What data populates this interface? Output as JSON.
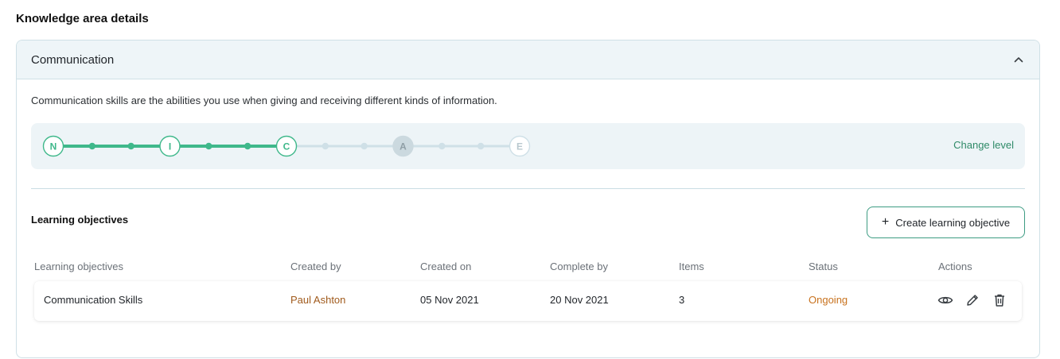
{
  "page_title": "Knowledge area details",
  "area": {
    "title": "Communication",
    "description": "Communication skills are the abilities you use when giving and receiving different kinds of information."
  },
  "level": {
    "stages": [
      "N",
      "I",
      "C",
      "A",
      "E"
    ],
    "current_stage": "C",
    "progress_stage_index": 2,
    "change_label": "Change level",
    "colors": {
      "done": "#3fb88b",
      "pending": "#cfe0e7",
      "highlight": "#cbd9df"
    }
  },
  "objectives": {
    "section_title": "Learning objectives",
    "create_label": "Create learning objective",
    "columns": [
      "Learning objectives",
      "Created by",
      "Created on",
      "Complete by",
      "Items",
      "Status",
      "Actions"
    ],
    "rows": [
      {
        "name": "Communication Skills",
        "created_by": "Paul Ashton",
        "created_on": "05 Nov 2021",
        "complete_by": "20 Nov 2021",
        "items": "3",
        "status": "Ongoing",
        "actions": [
          "eye-icon",
          "pencil-icon",
          "trash-icon"
        ]
      }
    ]
  }
}
